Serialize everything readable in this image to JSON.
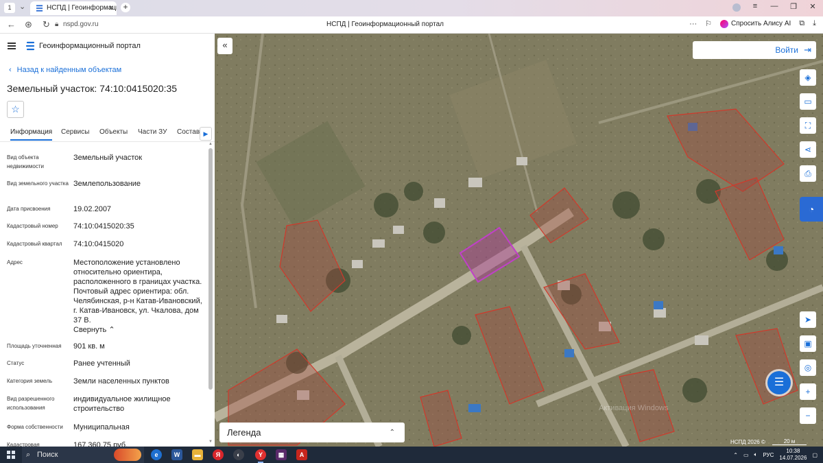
{
  "browser": {
    "tab_count": "1",
    "tab_title": "НСПД | Геоинформаци",
    "url": "nspd.gov.ru",
    "page_title": "НСПД | Геоинформационный портал",
    "alice_label": "Спросить Алису AI"
  },
  "panel": {
    "portal_name": "Геоинформационный портал",
    "back_label": "Назад к найденным объектам",
    "object_title": "Земельный участок: 74:10:0415020:35",
    "tabs": [
      "Информация",
      "Сервисы",
      "Объекты",
      "Части ЗУ",
      "Состав"
    ],
    "collapse_label": "Свернуть",
    "fields": [
      {
        "k": "Вид объекта недвижимости",
        "v": "Земельный участок"
      },
      {
        "k": "Вид земельного участка",
        "v": "Землепользование"
      },
      {
        "k": "Дата присвоения",
        "v": "19.02.2007"
      },
      {
        "k": "Кадастровый номер",
        "v": "74:10:0415020:35"
      },
      {
        "k": "Кадастровый квартал",
        "v": "74:10:0415020"
      },
      {
        "k": "Адрес",
        "v": "Местоположение установлено относительно ориентира, расположенного в границах участка. Почтовый адрес ориентира: обл. Челябинская, р-н Катав-Ивановский, г. Катав-Ивановск, ул. Чкалова, дом 37 В."
      },
      {
        "k": "Площадь уточненная",
        "v": "901 кв. м"
      },
      {
        "k": "Статус",
        "v": "Ранее учтенный"
      },
      {
        "k": "Категория земель",
        "v": "Земли населенных пунктов"
      },
      {
        "k": "Вид разрешенного использования",
        "v": "индивидуальное жилищное строительство"
      },
      {
        "k": "Форма собственности",
        "v": "Муниципальная"
      },
      {
        "k": "Кадастровая",
        "v": "167 360,75 руб."
      }
    ]
  },
  "map": {
    "login_label": "Войти",
    "legend_label": "Легенда",
    "attribution": "НСПД 2026 ©",
    "scale_label": "20 м",
    "watermark": "Активация Windows",
    "highlight_color": "#c040c8",
    "parcel_color": "#d0392b"
  },
  "taskbar": {
    "search_label": "Поиск",
    "lang": "РУС",
    "time": "10:38",
    "date": "14.07.2026"
  }
}
